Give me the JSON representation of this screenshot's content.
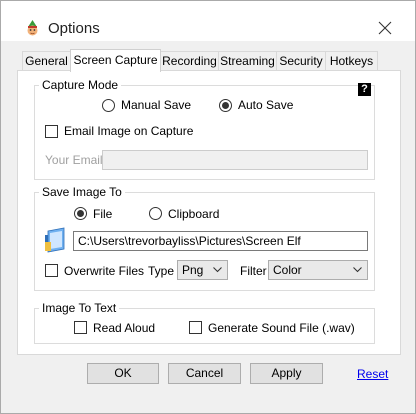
{
  "window": {
    "title": "Options",
    "app_icon": "elf-icon",
    "close_icon": "close-icon"
  },
  "tabs": [
    {
      "label": "General",
      "active": false
    },
    {
      "label": "Screen Capture",
      "active": true
    },
    {
      "label": "Recording",
      "active": false
    },
    {
      "label": "Streaming",
      "active": false
    },
    {
      "label": "Security",
      "active": false
    },
    {
      "label": "Hotkeys",
      "active": false
    }
  ],
  "capture_mode": {
    "title": "Capture Mode",
    "help_label": "?",
    "manual_save_label": "Manual Save",
    "auto_save_label": "Auto Save",
    "selected": "Auto Save",
    "email_image_label": "Email Image on Capture",
    "email_image_checked": false,
    "your_email_label": "Your Email",
    "your_email_value": ""
  },
  "save_image_to": {
    "title": "Save Image To",
    "file_label": "File",
    "clipboard_label": "Clipboard",
    "selected": "File",
    "folder_icon": "folder-icon",
    "path_value": "C:\\Users\\trevorbayliss\\Pictures\\Screen Elf",
    "overwrite_label": "Overwrite Files",
    "overwrite_checked": false,
    "type_label": "Type",
    "type_value": "Png",
    "filter_label": "Filter",
    "filter_value": "Color"
  },
  "image_to_text": {
    "title": "Image To Text",
    "read_aloud_label": "Read Aloud",
    "read_aloud_checked": false,
    "generate_sound_label": "Generate Sound File (.wav)",
    "generate_sound_checked": false
  },
  "buttons": {
    "ok": "OK",
    "cancel": "Cancel",
    "apply": "Apply",
    "reset": "Reset"
  },
  "colors": {
    "link": "#0000ee",
    "dialog_bg": "#f0f0f0",
    "panel_bg": "#ffffff"
  }
}
